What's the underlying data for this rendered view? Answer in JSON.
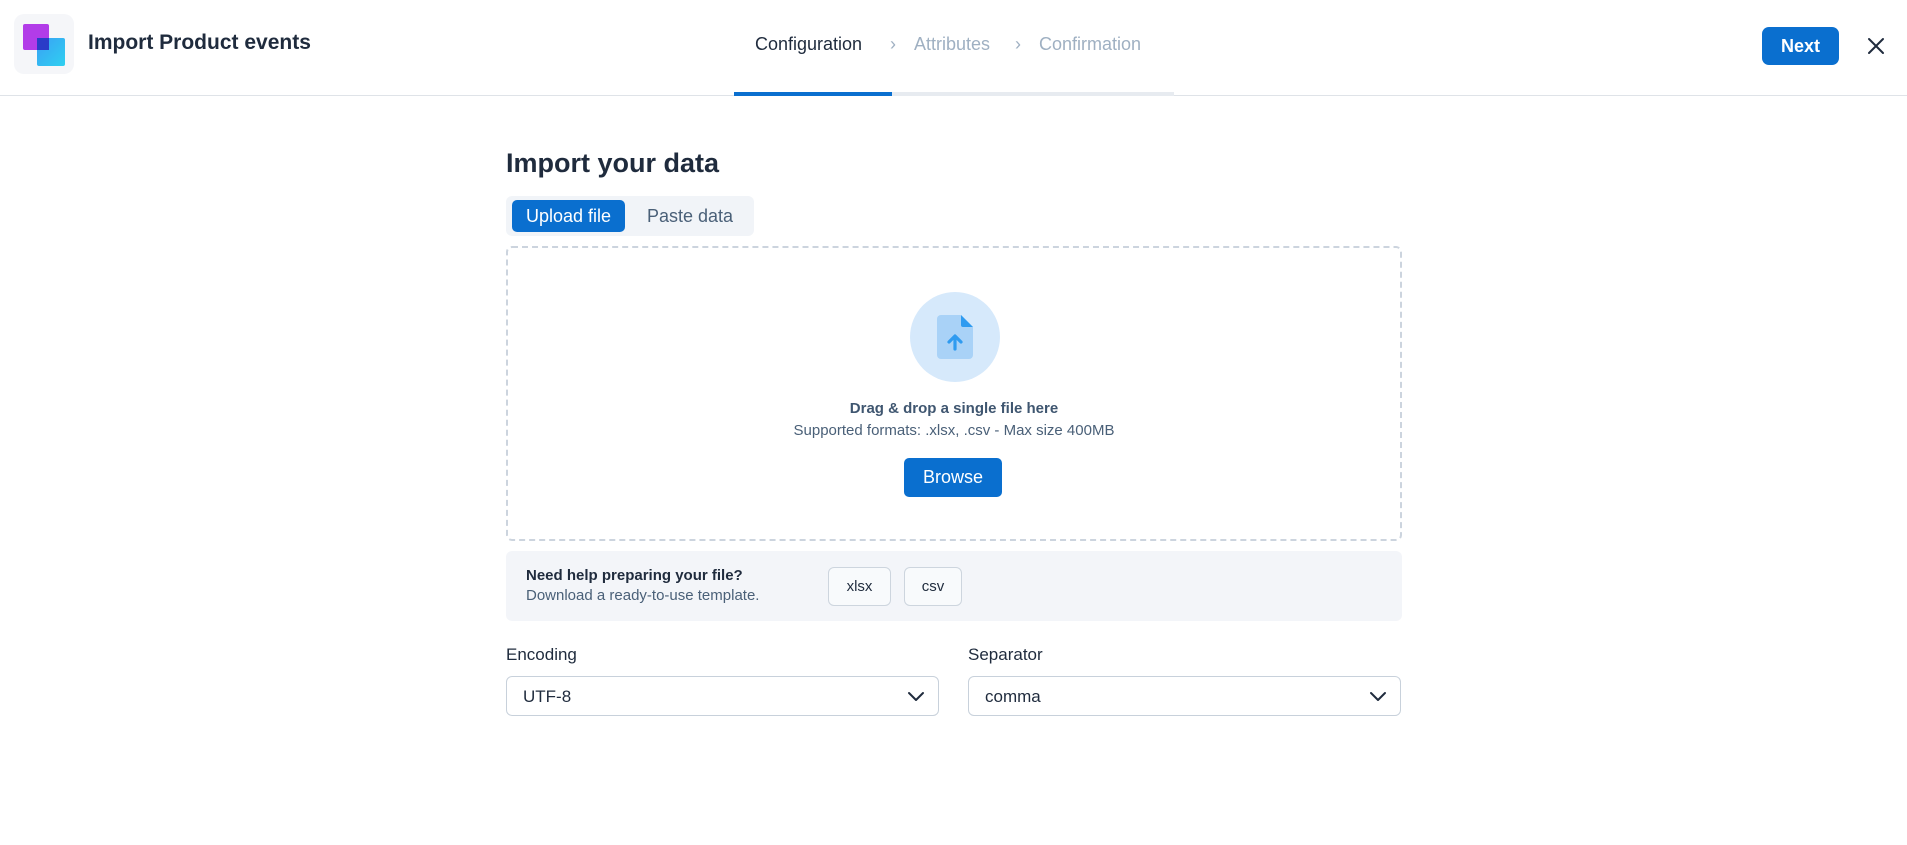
{
  "header": {
    "title": "Import Product events",
    "steps": [
      {
        "label": "Configuration",
        "state": "active"
      },
      {
        "label": "Attributes",
        "state": "inactive"
      },
      {
        "label": "Confirmation",
        "state": "inactive"
      }
    ],
    "step_progress": 0.36,
    "next_label": "Next"
  },
  "main": {
    "title": "Import your data",
    "tabs": [
      {
        "label": "Upload file",
        "selected": true
      },
      {
        "label": "Paste data",
        "selected": false
      }
    ],
    "dropzone": {
      "icon": "file-upload-icon",
      "title": "Drag & drop a single file here",
      "subtitle": "Supported formats: .xlsx, .csv - Max size 400MB",
      "browse_label": "Browse"
    },
    "help": {
      "title": "Need help preparing your file?",
      "subtitle": "Download a ready-to-use template.",
      "templates": [
        "xlsx",
        "csv"
      ]
    },
    "encoding": {
      "label": "Encoding",
      "value": "UTF-8"
    },
    "separator": {
      "label": "Separator",
      "value": "comma"
    }
  },
  "colors": {
    "accent": "#0a6fcf",
    "inactive_step": "#9fb0c2"
  }
}
